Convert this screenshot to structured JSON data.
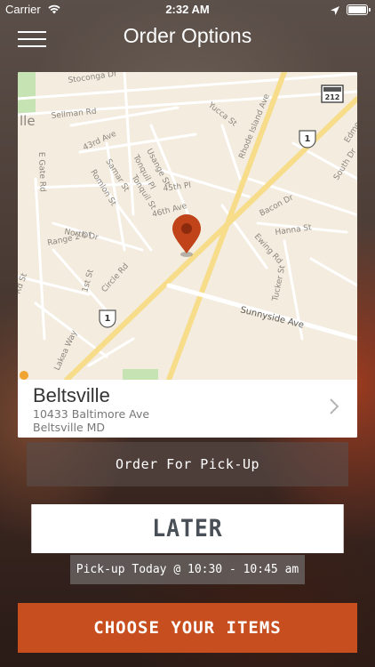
{
  "status_bar": {
    "carrier": "Carrier",
    "time": "2:32 AM",
    "wifi_icon": "wifi-icon",
    "location_icon": "location-arrow-icon",
    "battery_icon": "battery-icon"
  },
  "nav": {
    "title": "Order Options",
    "menu_icon": "hamburger-menu-icon"
  },
  "map": {
    "pin_icon": "map-pin-icon",
    "pin_color": "#c0431a",
    "street_labels": [
      "Stoconga Dr",
      "Sellman Rd",
      "43rd Ave",
      "Usange St",
      "Tonquil Pl",
      "Samar St",
      "Tonquil St",
      "45th Pl",
      "Romlon St",
      "46th Ave",
      "E Gate Rd",
      "North Dr",
      "Range 2 Dr",
      "1st St",
      "Circle Rd",
      "Rhode Island Ave",
      "Yucca St",
      "Bacon Dr",
      "Hanna St",
      "Ewing Rd",
      "Tucker St",
      "Sunnyside Ave",
      "South Dr",
      "Edmonston Rd",
      "Rd St",
      "Lakea Way"
    ],
    "route_shields": [
      "1",
      "1",
      "212"
    ],
    "partial_label": "lle"
  },
  "location": {
    "name": "Beltsville",
    "address_line1": "10433 Baltimore Ave",
    "address_line2": "Beltsville MD"
  },
  "order_type": {
    "label": "Order For Pick-Up"
  },
  "timing": {
    "label": "LATER",
    "pickup_text": "Pick-up Today @ 10:30 - 10:45 am"
  },
  "cta": {
    "label": "CHOOSE YOUR ITEMS",
    "color": "#c74f1f"
  }
}
